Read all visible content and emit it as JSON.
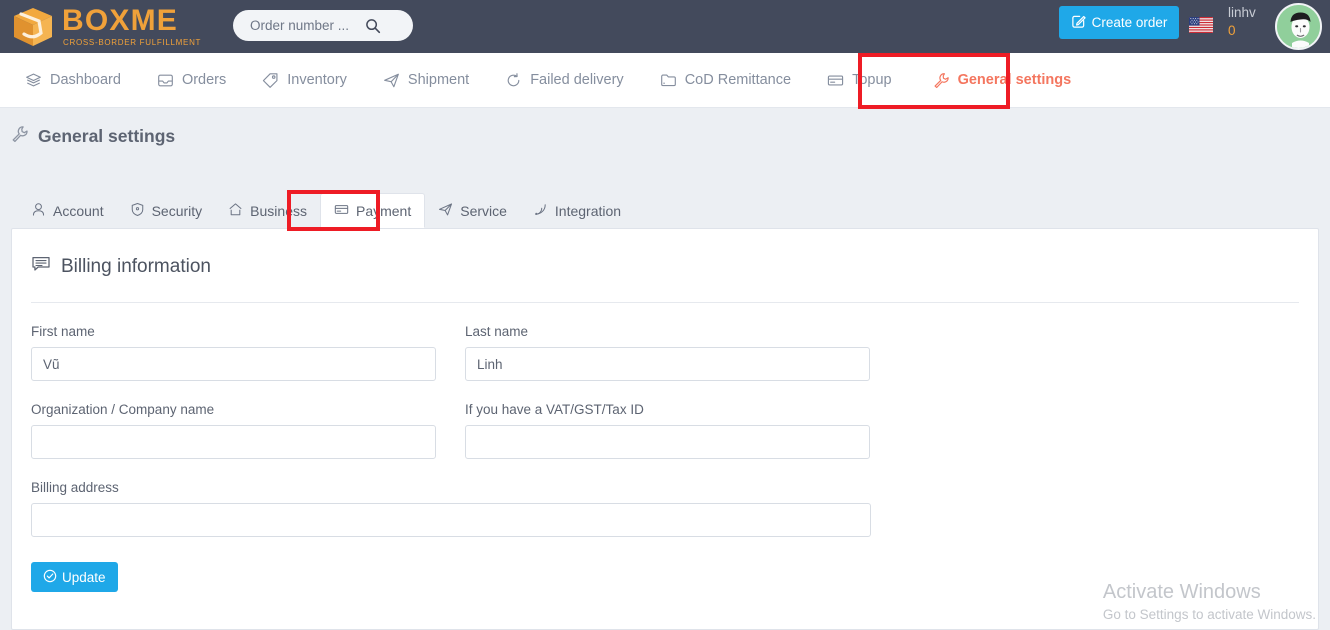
{
  "header": {
    "logo_title": "BOXME",
    "logo_sub": "CROSS-BORDER FULFILLMENT",
    "logo_icon": "box-icon",
    "search_placeholder": "Order number ...",
    "search_value": "",
    "search_icon": "search-icon",
    "create_order_label": "Create order",
    "create_order_icon": "edit-square-icon",
    "flag_icon": "us-flag-icon",
    "user_name": "linhv",
    "user_count": "0",
    "avatar_icon": "user-avatar"
  },
  "mainnav": {
    "items": [
      {
        "label": "Dashboard",
        "icon": "layers-icon",
        "active": false
      },
      {
        "label": "Orders",
        "icon": "inbox-icon",
        "active": false
      },
      {
        "label": "Inventory",
        "icon": "tag-icon",
        "active": false
      },
      {
        "label": "Shipment",
        "icon": "plane-icon",
        "active": false
      },
      {
        "label": "Failed delivery",
        "icon": "refresh-icon",
        "active": false
      },
      {
        "label": "CoD Remittance",
        "icon": "folder-icon",
        "active": false
      },
      {
        "label": "Topup",
        "icon": "credit-card-icon",
        "active": false
      },
      {
        "label": "General settings",
        "icon": "wrench-icon",
        "active": true
      }
    ]
  },
  "page": {
    "title": "General settings",
    "title_icon": "wrench-icon"
  },
  "tabs": {
    "items": [
      {
        "label": "Account",
        "icon": "user-icon",
        "active": false
      },
      {
        "label": "Security",
        "icon": "shield-icon",
        "active": false
      },
      {
        "label": "Business",
        "icon": "home-icon",
        "active": false
      },
      {
        "label": "Payment",
        "icon": "credit-card-icon",
        "active": true
      },
      {
        "label": "Service",
        "icon": "send-icon",
        "active": false
      },
      {
        "label": "Integration",
        "icon": "rss-icon",
        "active": false
      }
    ]
  },
  "billing": {
    "section_title": "Billing information",
    "section_icon": "comment-icon",
    "fields": {
      "first_name": {
        "label": "First name",
        "value": "Vũ",
        "placeholder": ""
      },
      "last_name": {
        "label": "Last name",
        "value": "Linh",
        "placeholder": ""
      },
      "organization": {
        "label": "Organization / Company name",
        "value": "",
        "placeholder": ""
      },
      "tax_id": {
        "label": "If you have a VAT/GST/Tax ID",
        "value": "",
        "placeholder": ""
      },
      "address": {
        "label": "Billing address",
        "value": "",
        "placeholder": ""
      }
    },
    "update_label": "Update",
    "update_icon": "check-circle-icon"
  },
  "watermark": {
    "title": "Activate Windows",
    "subtitle": "Go to Settings to activate Windows."
  },
  "annotations": [
    {
      "name": "general-settings-highlight",
      "color": "#ee1c25"
    },
    {
      "name": "payment-tab-highlight",
      "color": "#ee1c25"
    }
  ],
  "colors": {
    "topbar_bg": "#434a5c",
    "brand_orange": "#f0a13a",
    "accent_blue": "#1fa8e8",
    "active_nav": "#f4765f",
    "page_bg": "#eceff3",
    "annotation_red": "#ee1c25"
  }
}
